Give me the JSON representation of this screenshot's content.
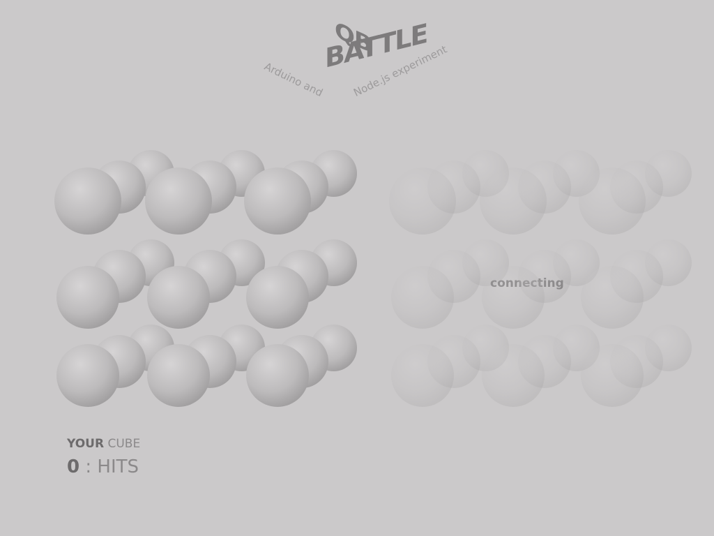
{
  "logo": {
    "line1": "QB",
    "line2": "BATTLE",
    "subtitle_left": "Arduino and",
    "subtitle_right": "Node.js experiment"
  },
  "left_cube": {
    "label_strong": "YOUR",
    "label_rest": "CUBE",
    "hits_count": "0",
    "hits_sep": ":",
    "hits_label": "HITS"
  },
  "right_cube": {
    "status": "connecting"
  },
  "colors": {
    "background": "#cbc9ca",
    "text_dark": "#6d6b6c",
    "text_light": "#8b898a"
  }
}
